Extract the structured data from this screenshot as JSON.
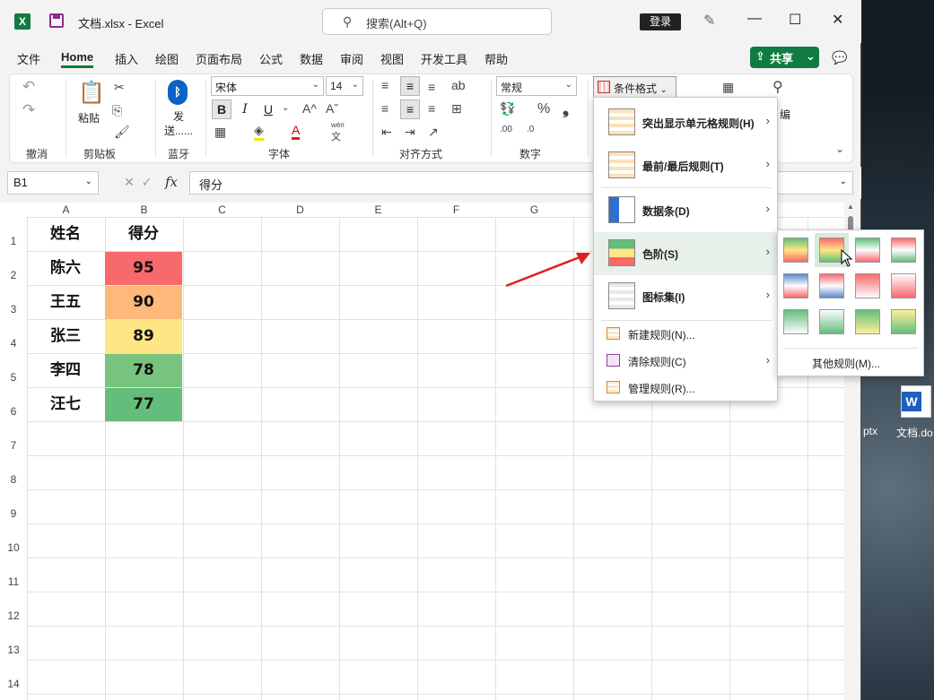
{
  "window": {
    "title": "文档.xlsx  -  Excel",
    "search_placeholder": "搜索(Alt+Q)",
    "login": "登录"
  },
  "tabs": [
    "文件",
    "Home",
    "插入",
    "绘图",
    "页面布局",
    "公式",
    "数据",
    "审阅",
    "视图",
    "开发工具",
    "帮助"
  ],
  "share": "共享",
  "ribbon": {
    "groups": {
      "undo": "撤消",
      "clipboard": "剪贴板",
      "bluetooth": "蓝牙",
      "font": "字体",
      "align": "对齐方式",
      "number": "数字"
    },
    "paste": "粘贴",
    "send": "发",
    "send2": "送......",
    "font_name": "宋体",
    "font_size": "14",
    "number_format": "常规",
    "conditional_format": "条件格式",
    "wen": "wén",
    "wen2": "文",
    "edit_partial": "编",
    "bold": "B",
    "italic": "I",
    "underline": "U",
    "font_color_a": "A",
    "grow_a": "A",
    "shrink_a": "A",
    "percent": "%",
    "comma": "❟",
    "dec_inc": ".00",
    "dec_dec": ".0"
  },
  "formula_bar": {
    "name_box": "B1",
    "fx": "fx",
    "content": "得分"
  },
  "sheet": {
    "columns": [
      "A",
      "B",
      "C",
      "D",
      "E",
      "F",
      "G"
    ],
    "rows": [
      "1",
      "2",
      "3",
      "4",
      "5",
      "6",
      "7",
      "8",
      "9",
      "10",
      "11",
      "12",
      "13",
      "14"
    ],
    "header": [
      "姓名",
      "得分"
    ],
    "data": [
      {
        "name": "陈六",
        "score": "95",
        "color": "#f8696b"
      },
      {
        "name": "王五",
        "score": "90",
        "color": "#fcb979"
      },
      {
        "name": "张三",
        "score": "89",
        "color": "#ffe583"
      },
      {
        "name": "李四",
        "score": "78",
        "color": "#76c47d"
      },
      {
        "name": "汪七",
        "score": "77",
        "color": "#63be7b"
      }
    ]
  },
  "cond_menu": {
    "items": [
      {
        "label": "突出显示单元格规则(H)"
      },
      {
        "label": "最前/最后规则(T)"
      },
      {
        "label": "数据条(D)"
      },
      {
        "label": "色阶(S)"
      },
      {
        "label": "图标集(I)"
      }
    ],
    "small_items": [
      {
        "label": "新建规则(N)..."
      },
      {
        "label": "清除规则(C)"
      },
      {
        "label": "管理规则(R)..."
      }
    ],
    "submenu_more": "其他规则(M)..."
  },
  "desktop": {
    "label_left": "ptx",
    "label_right": "文档.do"
  },
  "colors": {
    "excel_green": "#107c41",
    "annotation_red": "#e02020"
  }
}
